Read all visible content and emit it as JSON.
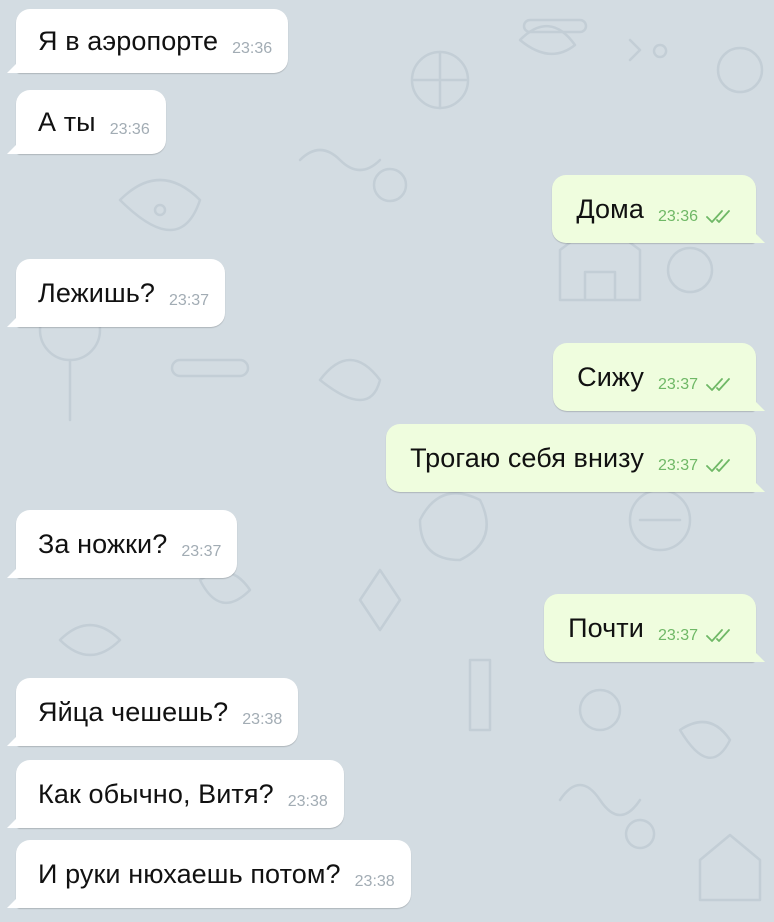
{
  "chat": {
    "background_color": "#d3dce2",
    "incoming_bubble_color": "#ffffff",
    "outgoing_bubble_color": "#effdde",
    "timestamp_color_incoming": "#a2acb4",
    "timestamp_color_outgoing": "#6fb866",
    "read_receipt_icon": "double-check-icon",
    "messages": [
      {
        "direction": "incoming",
        "text": "Я в аэропорте",
        "time": "23:36"
      },
      {
        "direction": "incoming",
        "text": "А ты",
        "time": "23:36"
      },
      {
        "direction": "outgoing",
        "text": "Дома",
        "time": "23:36",
        "read": true
      },
      {
        "direction": "incoming",
        "text": "Лежишь?",
        "time": "23:37"
      },
      {
        "direction": "outgoing",
        "text": "Сижу",
        "time": "23:37",
        "read": true
      },
      {
        "direction": "outgoing",
        "text": "Трогаю себя внизу",
        "time": "23:37",
        "read": true
      },
      {
        "direction": "incoming",
        "text": "За ножки?",
        "time": "23:37"
      },
      {
        "direction": "outgoing",
        "text": "Почти",
        "time": "23:37",
        "read": true
      },
      {
        "direction": "incoming",
        "text": "Яйца чешешь?",
        "time": "23:38"
      },
      {
        "direction": "incoming",
        "text": "Как обычно, Витя?",
        "time": "23:38"
      },
      {
        "direction": "incoming",
        "text": "И руки нюхаешь потом?",
        "time": "23:38"
      }
    ]
  }
}
